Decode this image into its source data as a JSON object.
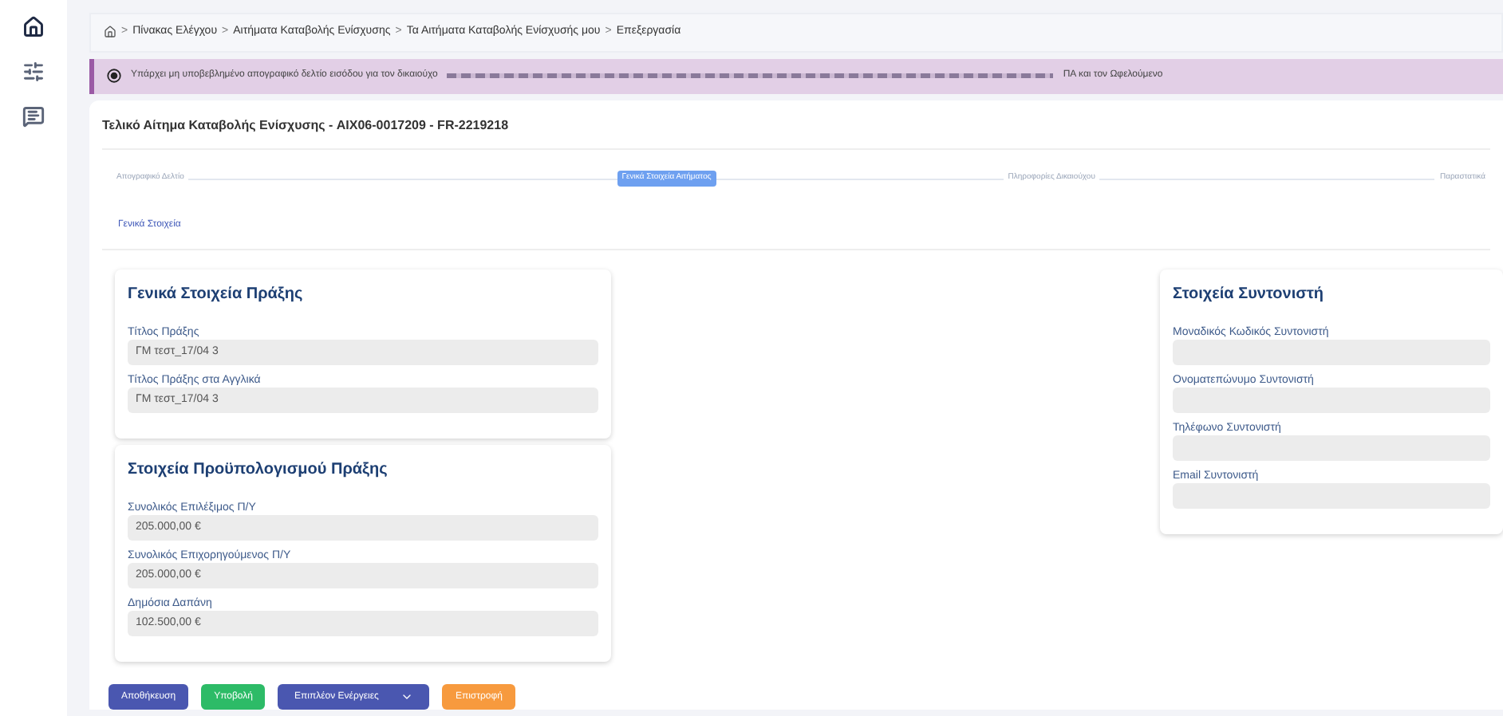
{
  "sidebar": {
    "items": [
      {
        "kind": "home",
        "selected": true
      },
      {
        "kind": "sliders",
        "selected": false
      },
      {
        "kind": "chat",
        "selected": false
      }
    ]
  },
  "breadcrumb_separator": ">",
  "breadcrumb": [
    "Πίνακας Ελέγχου",
    "Αιτήματα Καταβολής Ενίσχυσης",
    "Τα Αιτήματα Καταβολής Ενίσχυσής μου",
    "Επεξεργασία"
  ],
  "alert": {
    "text_start": "Υπάρχει μη υποβεβλημένο απογραφικό δελτίο εισόδου για τον δικαιούχο",
    "text_end": "ΠΑ και τον Ωφελούμενο"
  },
  "page_title": "Τελικό Αίτημα Καταβολής Ενίσχυσης - AIX06-0017209 - FR-2219218",
  "steps": [
    {
      "label": "Απογραφικό Δελτίο",
      "selected": false
    },
    {
      "label": "Γενικά Στοιχεία Αιτήματος",
      "selected": true
    },
    {
      "label": "Πληροφορίες Δικαιούχου",
      "selected": false
    },
    {
      "label": "Παραστατικά",
      "selected": false
    }
  ],
  "subtab": "Γενικά Στοιχεία",
  "left_cards": [
    {
      "title": "Γενικά Στοιχεία Πράξης",
      "fields": [
        {
          "label": "Τίτλος Πράξης",
          "value": "ΓΜ τεστ_17/04 3"
        },
        {
          "label": "Τίτλος Πράξης στα Αγγλικά",
          "value": "ΓΜ τεστ_17/04 3"
        }
      ]
    },
    {
      "title": "Στοιχεία Προϋπολογισμού Πράξης",
      "fields": [
        {
          "label": "Συνολικός Επιλέξιμος Π/Υ",
          "value": "205.000,00 €"
        },
        {
          "label": "Συνολικός Επιχορηγούμενος Π/Υ",
          "value": "205.000,00 €"
        },
        {
          "label": "Δημόσια Δαπάνη",
          "value": "102.500,00 €"
        }
      ]
    }
  ],
  "coordinator_card": {
    "title": "Στοιχεία Συντονιστή",
    "fields": [
      {
        "label": "Μοναδικός Κωδικός Συντονιστή"
      },
      {
        "label": "Ονοματεπώνυμο Συντονιστή"
      },
      {
        "label": "Τηλέφωνο Συντονιστή"
      },
      {
        "label": "Email Συντονιστή"
      }
    ]
  },
  "buttons": [
    {
      "label": "Αποθήκευση",
      "kind": "save"
    },
    {
      "label": "Υποβολή",
      "kind": "submit"
    },
    {
      "label": "Επιπλέον Ενέργειες",
      "kind": "menu"
    },
    {
      "label": "Επιστροφή",
      "kind": "back"
    }
  ]
}
